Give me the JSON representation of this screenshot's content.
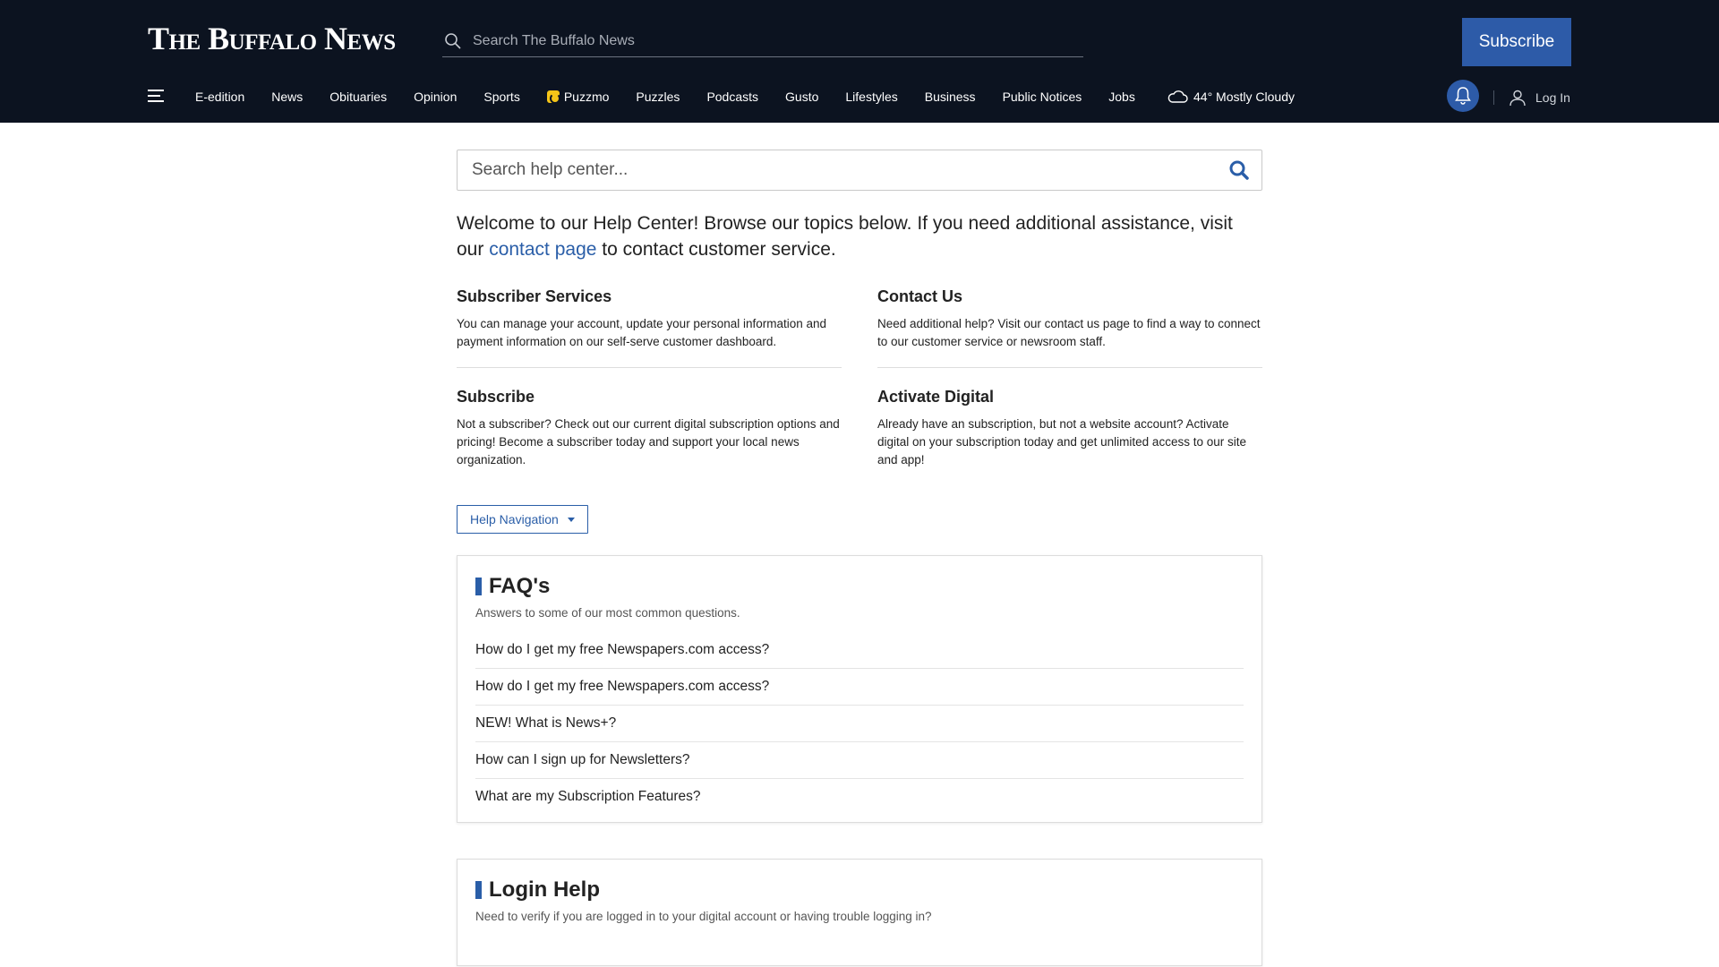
{
  "header": {
    "logo": "The Buffalo News",
    "search_placeholder": "Search The Buffalo News",
    "subscribe_label": "Subscribe",
    "nav": [
      "E-edition",
      "News",
      "Obituaries",
      "Opinion",
      "Sports",
      "Puzzmo",
      "Puzzles",
      "Podcasts",
      "Gusto",
      "Lifestyles",
      "Business",
      "Public Notices",
      "Jobs"
    ],
    "weather": "44° Mostly Cloudy",
    "login_label": "Log In"
  },
  "main": {
    "search_placeholder": "Search help center...",
    "welcome_before": "Welcome to our Help Center! Browse our topics below. If you need additional assistance, visit our ",
    "welcome_link": "contact page",
    "welcome_after": " to contact customer service.",
    "topics": [
      {
        "title": "Subscriber Services",
        "text": "You can manage your account, update your personal information and payment information on our self-serve customer dashboard."
      },
      {
        "title": "Contact Us",
        "text": "Need additional help? Visit our contact us page to find a way to connect to our customer service or newsroom staff."
      },
      {
        "title": "Subscribe",
        "text": "Not a subscriber? Check out our current digital subscription options and pricing! Become a subscriber today and support your local news organization."
      },
      {
        "title": "Activate Digital",
        "text": "Already have an subscription, but not a website account? Activate digital on your subscription today and get unlimited access to our site and app!"
      }
    ],
    "help_nav_label": "Help Navigation",
    "faq": {
      "title": "FAQ's",
      "subtitle": "Answers to some of our most common questions.",
      "items": [
        "How do I get my free Newspapers.com access?",
        "How do I get my free Newspapers.com access?",
        "NEW! What is News+?",
        "How can I sign up for Newsletters?",
        "What are my Subscription Features?"
      ]
    },
    "login_help": {
      "title": "Login Help",
      "subtitle": "Need to verify if you are logged in to your digital account or having trouble logging in?"
    }
  },
  "colors": {
    "header_bg": "#0c1320",
    "accent": "#2a5ea8",
    "subscribe_bg": "#2d5ba8"
  }
}
